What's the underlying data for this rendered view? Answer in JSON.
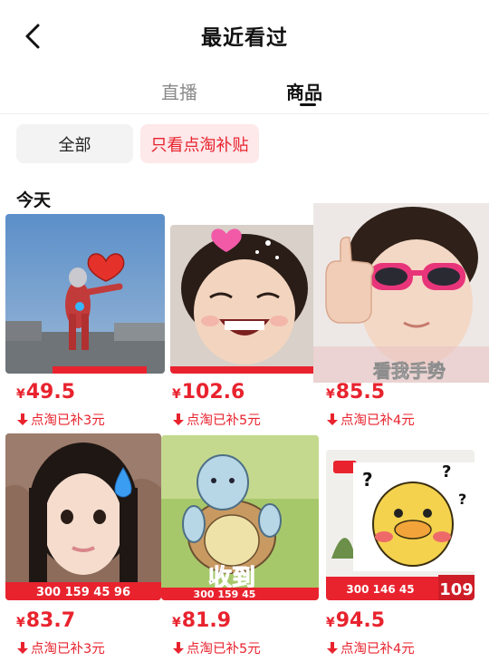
{
  "header": {
    "title": "最近看过"
  },
  "tabs": [
    {
      "label": "直播",
      "active": false
    },
    {
      "label": "商品",
      "active": true
    }
  ],
  "filters": [
    {
      "label": "全部",
      "selected": false
    },
    {
      "label": "只看点淘补贴",
      "selected": true
    }
  ],
  "section": {
    "date_label": "今天"
  },
  "products": [
    {
      "currency": "¥",
      "price": "49.5",
      "subsidy": "点淘已补3元",
      "image_icon": "ultraman-heart-image"
    },
    {
      "currency": "¥",
      "price": "102.6",
      "subsidy": "点淘已补5元",
      "image_icon": "smiling-girl-image"
    },
    {
      "currency": "¥",
      "price": "85.5",
      "subsidy": "点淘已补4元",
      "image_icon": "sunglasses-girl-image",
      "caption": "看我手势"
    },
    {
      "currency": "¥",
      "price": "83.7",
      "subsidy": "点淘已补3元",
      "image_icon": "crying-girl-image",
      "bottom_strip": "300  159  45  96"
    },
    {
      "currency": "¥",
      "price": "81.9",
      "subsidy": "点淘已补5元",
      "image_icon": "squirtle-image",
      "caption": "收到",
      "bottom_strip": "300  159  45"
    },
    {
      "currency": "¥",
      "price": "94.5",
      "subsidy": "点淘已补4元",
      "image_icon": "confused-duck-image",
      "bottom_strip": "300  146  45",
      "badge_price": "109"
    }
  ],
  "colors": {
    "accent": "#e8232e",
    "chip_active_bg": "#fde8ea",
    "chip_bg": "#f3f3f3"
  }
}
